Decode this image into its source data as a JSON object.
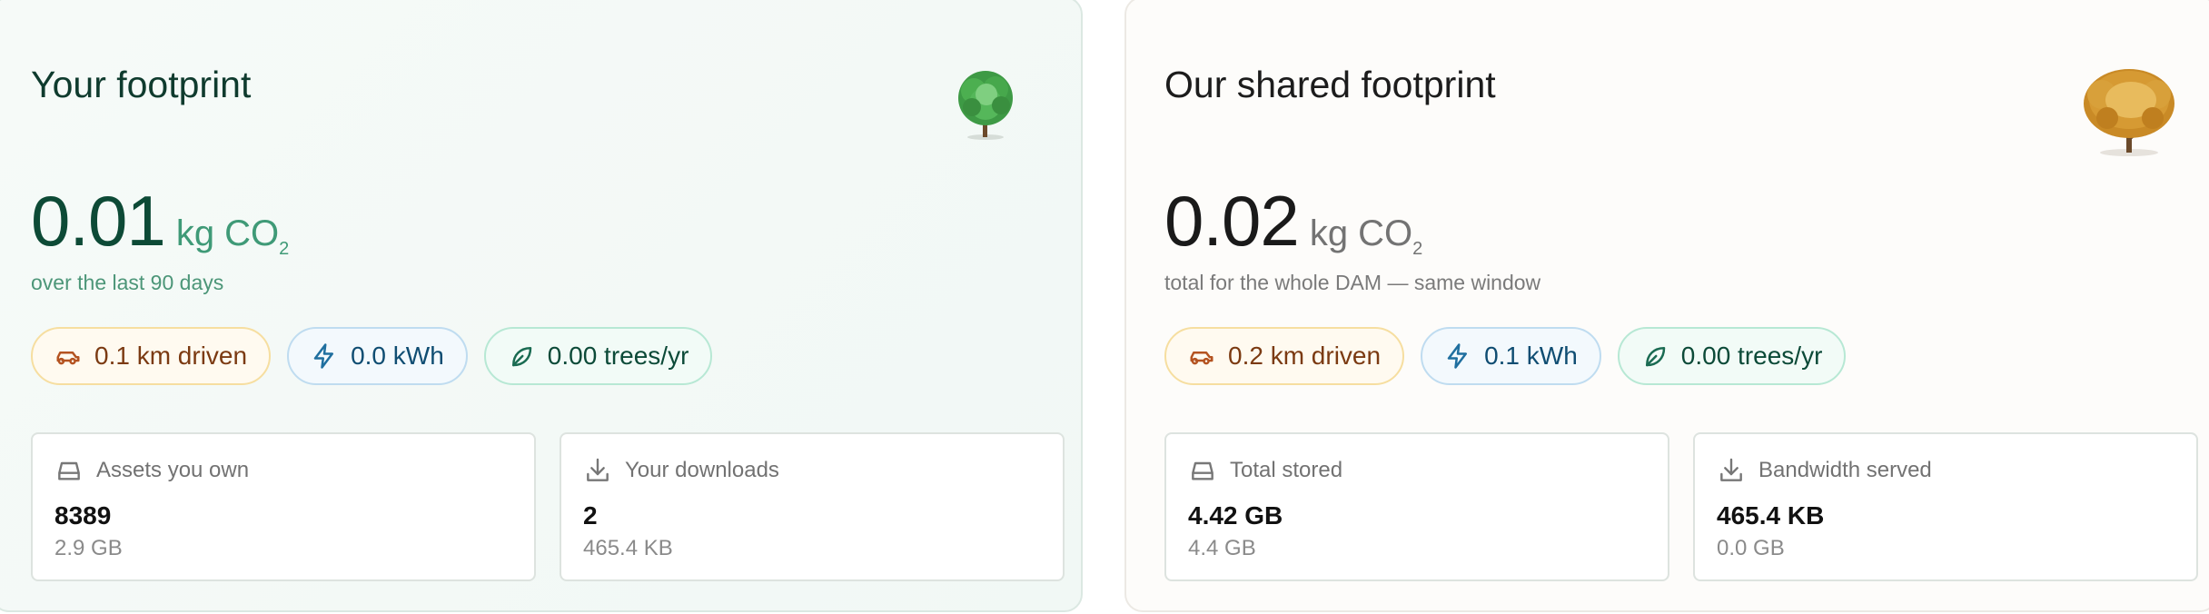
{
  "left": {
    "title": "Your footprint",
    "value": "0.01",
    "unit": "kg CO",
    "unit_sub": "2",
    "subtitle": "over the last 90 days",
    "chips": {
      "car": "0.1 km driven",
      "kwh": "0.0 kWh",
      "trees": "0.00 trees/yr"
    },
    "stats": [
      {
        "label": "Assets you own",
        "value": "8389",
        "sub": "2.9 GB"
      },
      {
        "label": "Your downloads",
        "value": "2",
        "sub": "465.4 KB"
      }
    ],
    "tree_color": "#4caf50"
  },
  "right": {
    "title": "Our shared footprint",
    "value": "0.02",
    "unit": "kg CO",
    "unit_sub": "2",
    "subtitle": "total for the whole DAM — same window",
    "chips": {
      "car": "0.2 km driven",
      "kwh": "0.1 kWh",
      "trees": "0.00 trees/yr"
    },
    "stats": [
      {
        "label": "Total stored",
        "value": "4.42 GB",
        "sub": "4.4 GB"
      },
      {
        "label": "Bandwidth served",
        "value": "465.4 KB",
        "sub": "0.0 GB"
      }
    ],
    "tree_color": "#d9a43c"
  }
}
